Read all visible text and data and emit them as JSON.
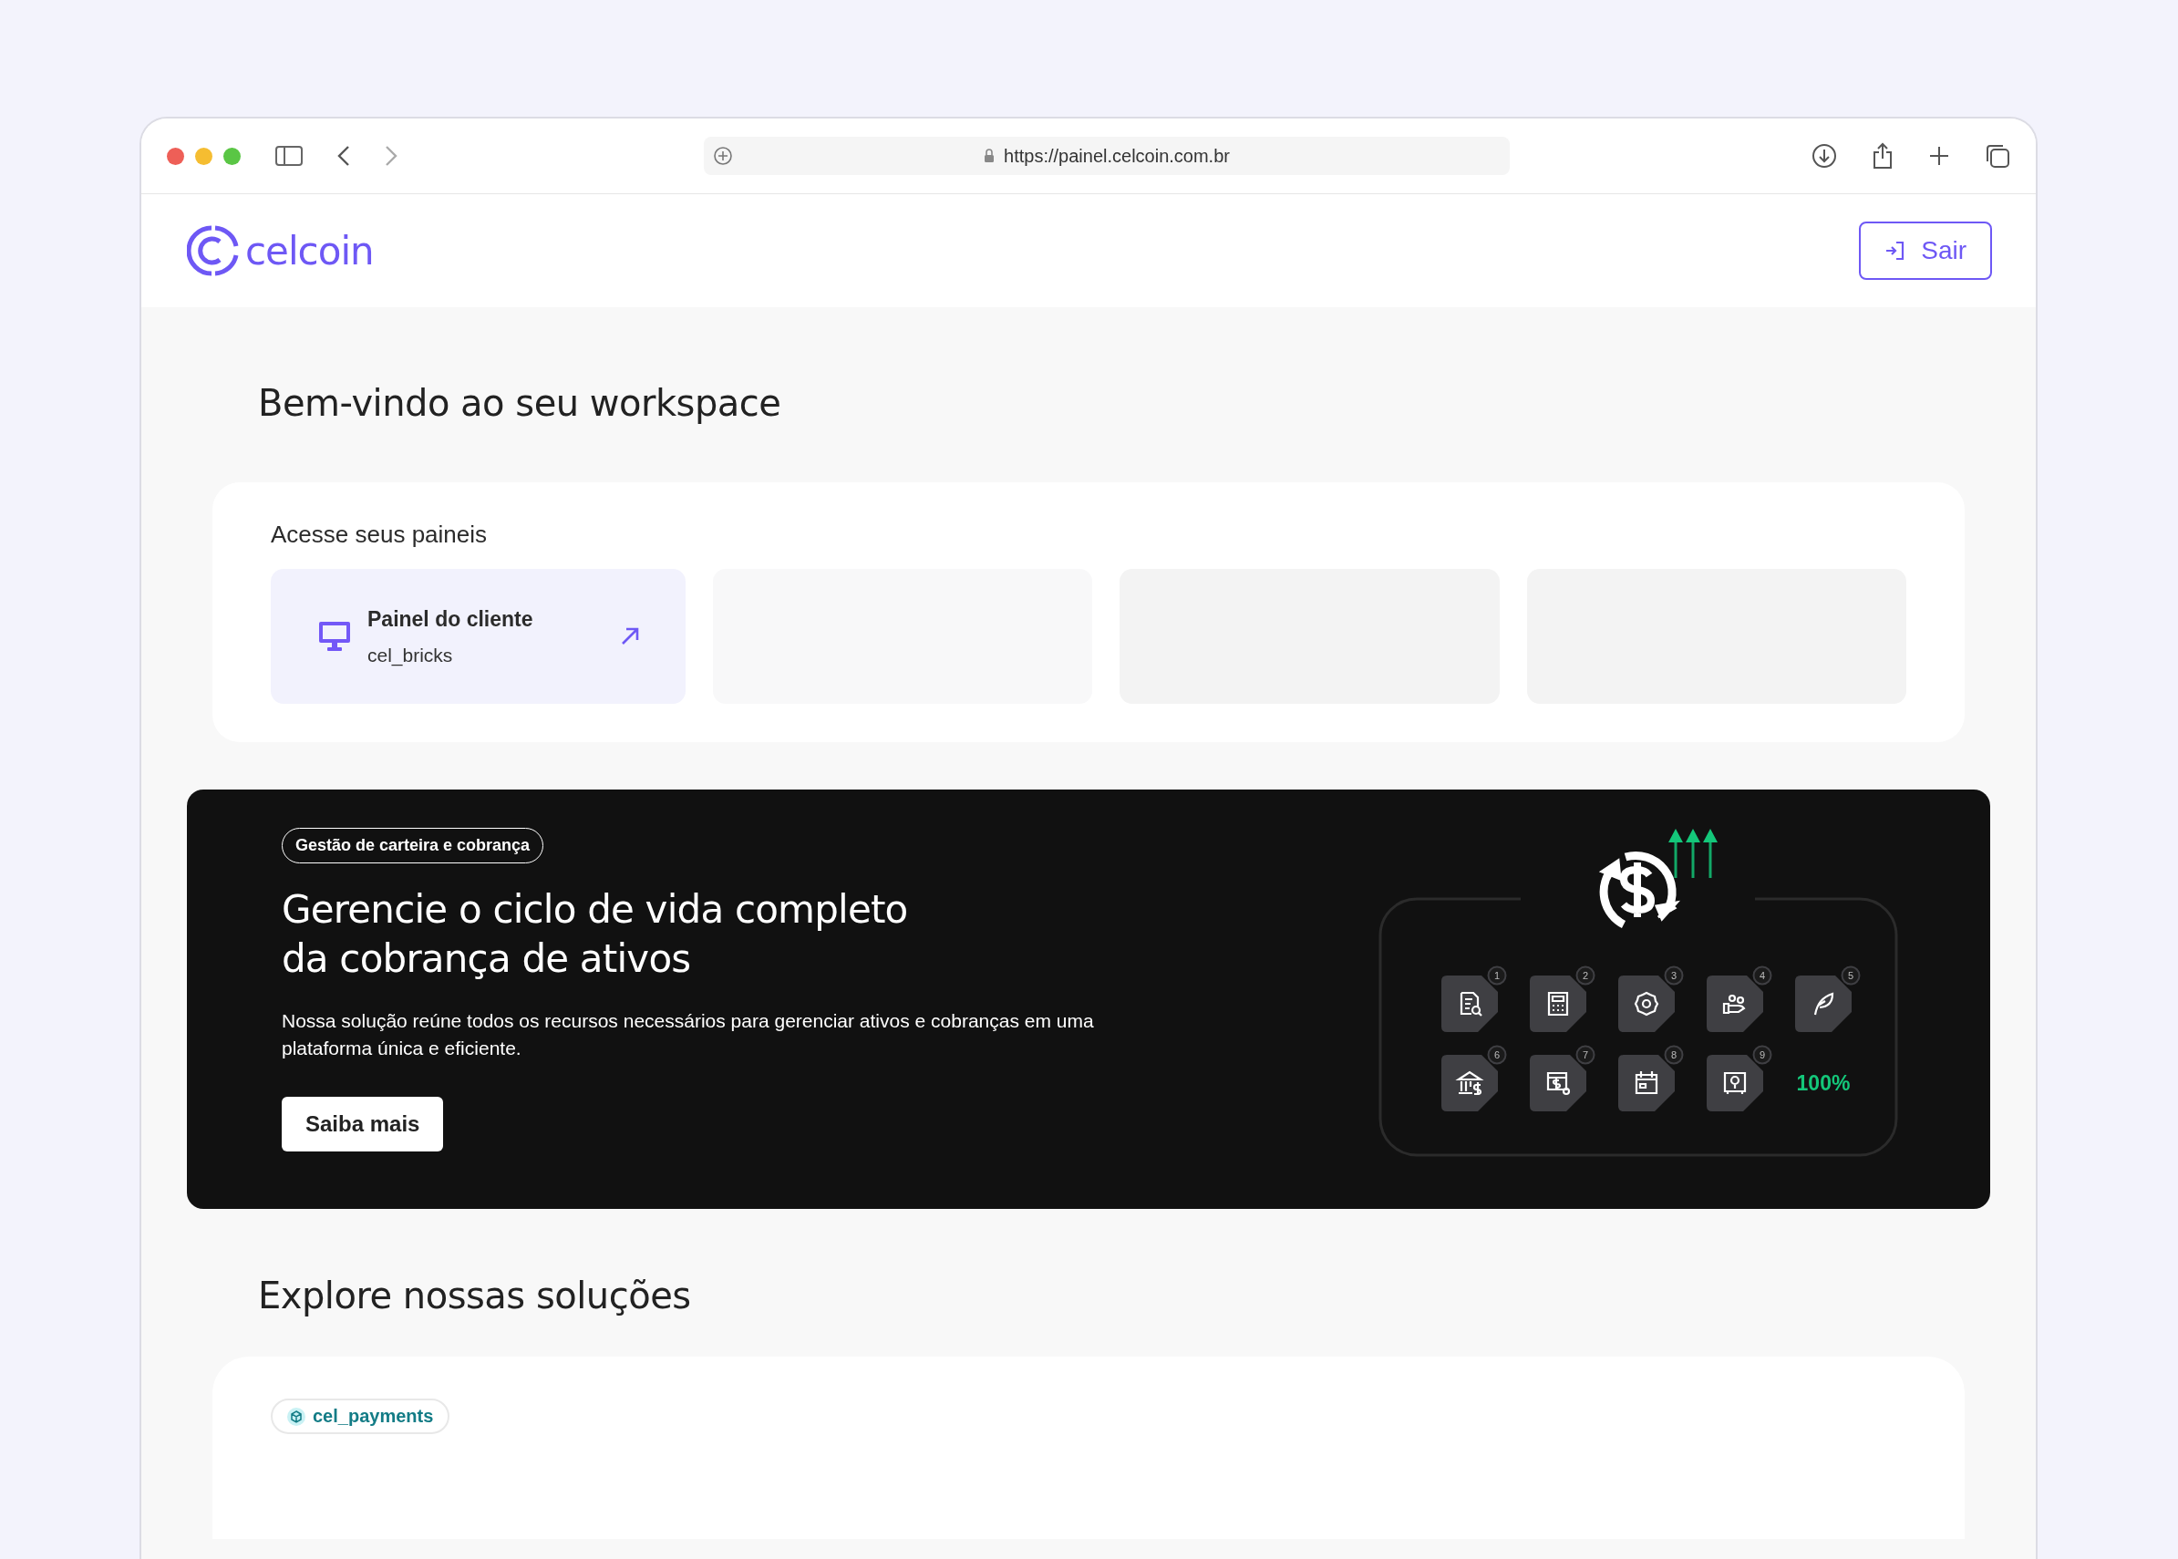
{
  "browser": {
    "url": "https://painel.celcoin.com.br"
  },
  "header": {
    "logo_text": "celcoin",
    "logout_button": "Sair"
  },
  "welcome_title": "Bem-vindo ao seu workspace",
  "panels": {
    "title": "Acesse seus paineis",
    "tiles": [
      {
        "kind": "panel",
        "title": "Painel do cliente",
        "subtitle": "cel_bricks"
      },
      {
        "kind": "placeholder"
      },
      {
        "kind": "placeholder"
      },
      {
        "kind": "placeholder"
      }
    ]
  },
  "banner": {
    "tag": "Gestão de carteira e cobrança",
    "title": "Gerencie o ciclo de vida completo da cobrança de ativos",
    "description": "Nossa solução reúne todos os recursos necessários para gerenciar ativos e cobranças em uma plataforma única e eficiente.",
    "button": "Saiba mais",
    "illustration": {
      "modules": [
        {
          "number": "1"
        },
        {
          "number": "2"
        },
        {
          "number": "3"
        },
        {
          "number": "4"
        },
        {
          "number": "5"
        },
        {
          "number": "6"
        },
        {
          "number": "7"
        },
        {
          "number": "8"
        },
        {
          "number": "9"
        }
      ],
      "progress": "100%"
    }
  },
  "solutions": {
    "title": "Explore nossas soluções",
    "tags": [
      {
        "label": "cel_payments"
      }
    ]
  }
}
